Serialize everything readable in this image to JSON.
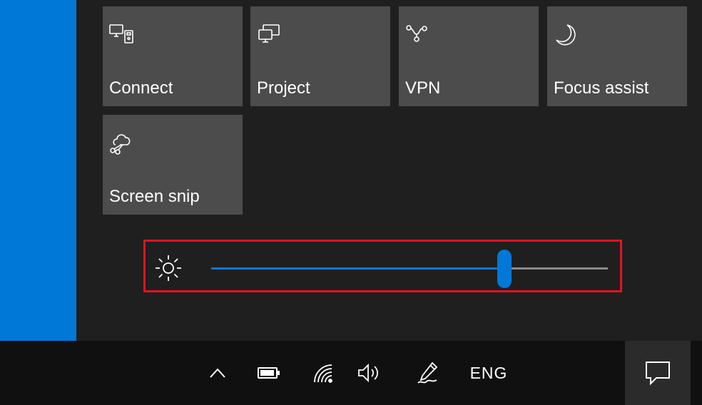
{
  "tiles": [
    {
      "label": "Connect",
      "icon": "connect-icon"
    },
    {
      "label": "Project",
      "icon": "project-icon"
    },
    {
      "label": "VPN",
      "icon": "vpn-icon"
    },
    {
      "label": "Focus assist",
      "icon": "moon-icon"
    },
    {
      "label": "Screen snip",
      "icon": "scissors-icon"
    }
  ],
  "brightness": {
    "icon": "sun-icon",
    "level": 0.74
  },
  "taskbar": {
    "icons": [
      "chevron-up-icon",
      "battery-icon",
      "wifi-icon",
      "volume-icon",
      "pen-icon",
      "notification-icon"
    ],
    "language": "ENG"
  },
  "colors": {
    "accent": "#0078d7",
    "tile": "#4c4c4c",
    "highlight": "#e81123",
    "panel": "#1f1f1f",
    "taskbar": "#101010"
  }
}
